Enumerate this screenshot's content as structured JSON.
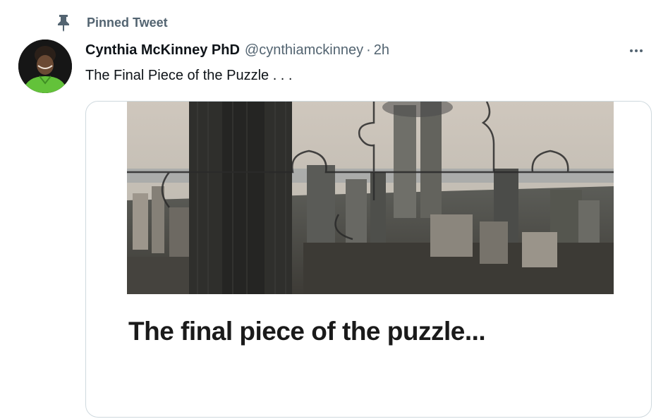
{
  "pinned": {
    "label": "Pinned Tweet"
  },
  "author": {
    "display_name": "Cynthia McKinney PhD",
    "handle": "@cynthiamckinney",
    "separator": "·",
    "time": "2h"
  },
  "tweet": {
    "text": "The Final Piece of the Puzzle . . ."
  },
  "media": {
    "caption": "The final piece of the puzzle..."
  },
  "icons": {
    "pin": "pin-icon",
    "more": "more-icon"
  },
  "colors": {
    "secondary_text": "#536471",
    "primary_text": "#0f1419",
    "border": "#cfd9de"
  }
}
